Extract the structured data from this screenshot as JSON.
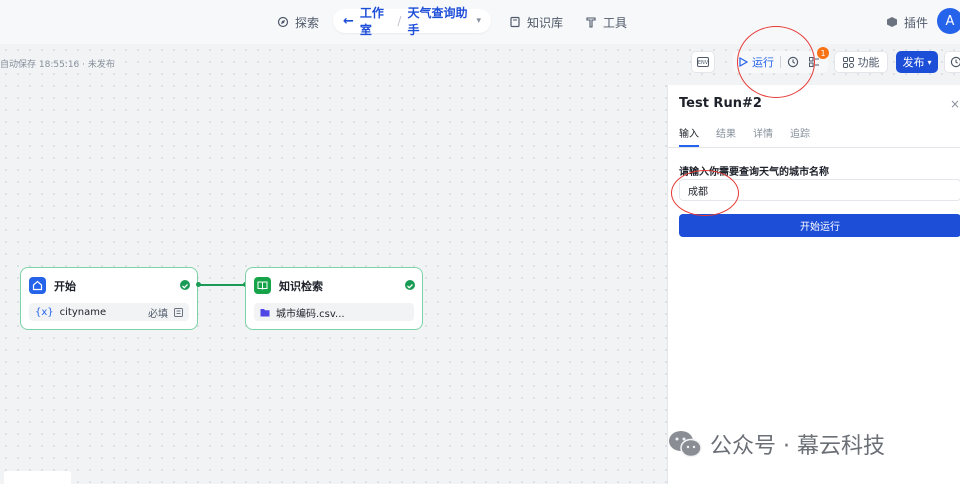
{
  "nav": {
    "explore": "探索",
    "studio": "工作室",
    "project": "天气查询助手",
    "knowledge": "知识库",
    "tools": "工具",
    "plugins": "插件",
    "avatar_initial": "A"
  },
  "status": {
    "autosave": "自动保存 18:55:16 · 未发布"
  },
  "toolbar": {
    "run": "运行",
    "badge_count": "1",
    "features": "功能",
    "publish": "发布"
  },
  "nodes": {
    "start": {
      "title": "开始",
      "var_prefix": "{x}",
      "var_name": "cityname",
      "required": "必填"
    },
    "retrieval": {
      "title": "知识检索",
      "file": "城市编码.csv..."
    }
  },
  "panel": {
    "title": "Test Run#2",
    "close": "×",
    "tabs": [
      "输入",
      "结果",
      "详情",
      "追踪"
    ],
    "field_label": "请输入你需要查询天气的城市名称",
    "field_value": "成都",
    "start_button": "开始运行"
  },
  "watermark": "公众号 · 幕云科技",
  "colors": {
    "accent": "#1d4ed8",
    "success": "#1a9b55",
    "node_border": "#7dd3a8",
    "badge": "#f97316",
    "annotation": "#e53935"
  }
}
